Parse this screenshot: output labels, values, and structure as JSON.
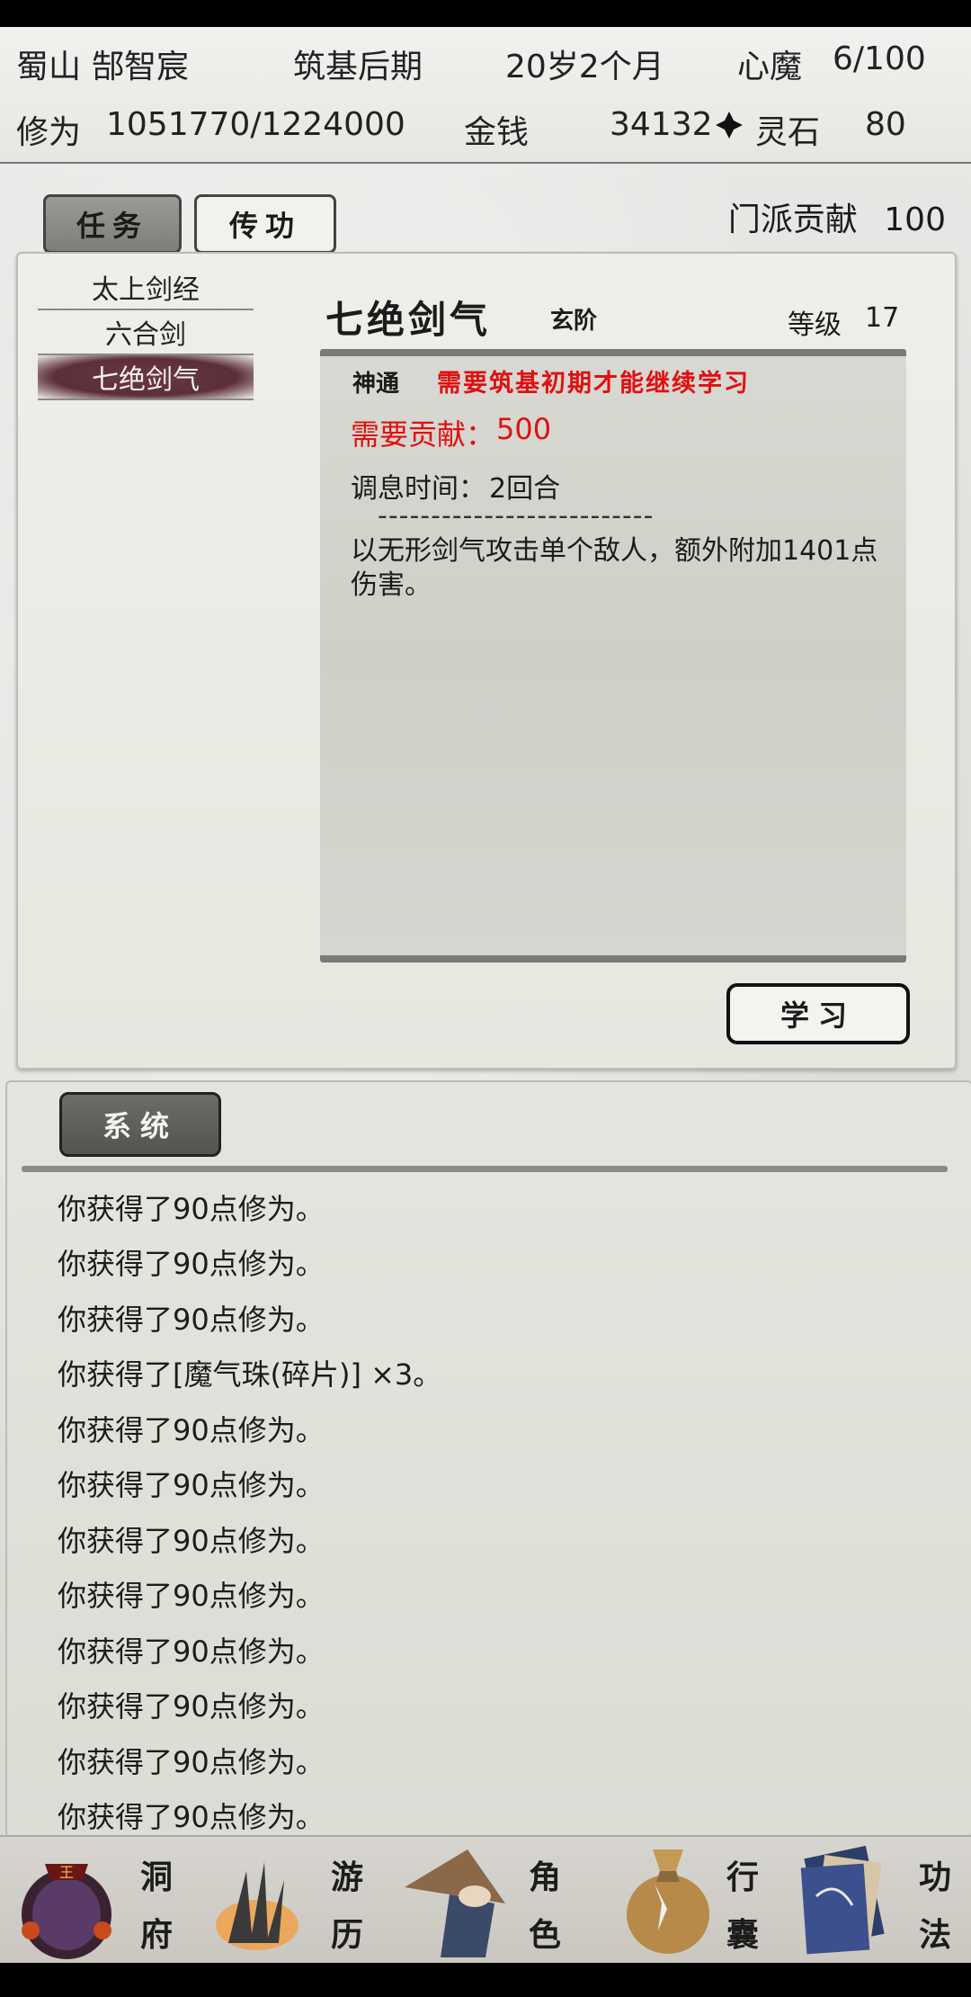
{
  "header": {
    "sect": "蜀山",
    "name": "郜智宸",
    "realm": "筑基后期",
    "age": "20岁2个月",
    "demon_label": "心魔",
    "demon_value": "6/100",
    "cultivation_label": "修为",
    "cultivation_value": "1051770/1224000",
    "money_label": "金钱",
    "money_value": "34132",
    "spirit_stone_label": "灵石",
    "spirit_stone_value": "80"
  },
  "tabs": [
    {
      "label": "任务",
      "active": true
    },
    {
      "label": "传功",
      "active": false
    }
  ],
  "contribution": {
    "label": "门派贡献",
    "value": "100"
  },
  "skills": {
    "items": [
      {
        "label": "太上剑经",
        "selected": false
      },
      {
        "label": "六合剑",
        "selected": false
      },
      {
        "label": "七绝剑气",
        "selected": true
      }
    ]
  },
  "detail": {
    "title": "七绝剑气",
    "tier": "玄阶",
    "level_label": "等级",
    "level_value": "17",
    "req_type": "神通",
    "req_text": "需要筑基初期才能继续学习",
    "cost_label": "需要贡献：",
    "cost_value": "500",
    "cooldown_label": "调息时间：",
    "cooldown_value": "2回合",
    "divider": "--------------------------",
    "description": "以无形剑气攻击单个敌人，额外附加1401点伤害。",
    "learn_button": "学习"
  },
  "system": {
    "tab_label": "系统",
    "log": [
      "你获得了90点修为。",
      "你获得了90点修为。",
      "你获得了90点修为。",
      "你获得了[魔气珠(碎片)] ×3。",
      "你获得了90点修为。",
      "你获得了90点修为。",
      "你获得了90点修为。",
      "你获得了90点修为。",
      "你获得了90点修为。",
      "你获得了90点修为。",
      "你获得了90点修为。",
      "你获得了90点修为。"
    ]
  },
  "nav": [
    {
      "top": "洞",
      "bottom": "府",
      "icon": "cave-dwelling-icon"
    },
    {
      "top": "游",
      "bottom": "历",
      "icon": "travel-icon"
    },
    {
      "top": "角",
      "bottom": "色",
      "icon": "character-icon"
    },
    {
      "top": "行",
      "bottom": "囊",
      "icon": "bag-icon"
    },
    {
      "top": "功",
      "bottom": "法",
      "icon": "technique-book-icon"
    }
  ],
  "colors": {
    "accent_red": "#e01010",
    "selected_item": "#5b2e38"
  }
}
